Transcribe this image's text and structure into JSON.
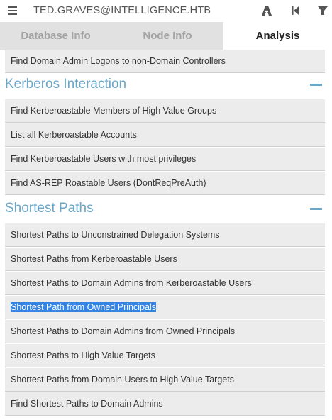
{
  "header": {
    "user": "TED.GRAVES@INTELLIGENCE.HTB",
    "menu_icon": "hamburger-icon",
    "icons": [
      "pathfinding-icon",
      "back-icon",
      "filter-icon"
    ]
  },
  "tabs": [
    {
      "label": "Database Info",
      "active": false
    },
    {
      "label": "Node Info",
      "active": false
    },
    {
      "label": "Analysis",
      "active": true
    }
  ],
  "queries_top": [
    {
      "label": "Find Domain Admin Logons to non-Domain Controllers"
    }
  ],
  "kerberos": {
    "title": "Kerberos Interaction",
    "items": [
      {
        "label": "Find Kerberoastable Members of High Value Groups"
      },
      {
        "label": "List all Kerberoastable Accounts"
      },
      {
        "label": "Find Kerberoastable Users with most privileges"
      },
      {
        "label": "Find AS-REP Roastable Users (DontReqPreAuth)"
      }
    ]
  },
  "shortest": {
    "title": "Shortest Paths",
    "items": [
      {
        "label": "Shortest Paths to Unconstrained Delegation Systems"
      },
      {
        "label": "Shortest Paths from Kerberoastable Users"
      },
      {
        "label": "Shortest Paths to Domain Admins from Kerberoastable Users"
      },
      {
        "label": "Shortest Path from Owned Principals",
        "selected": true
      },
      {
        "label": "Shortest Paths to Domain Admins from Owned Principals"
      },
      {
        "label": "Shortest Paths to High Value Targets"
      },
      {
        "label": "Shortest Paths from Domain Users to High Value Targets"
      },
      {
        "label": "Find Shortest Paths to Domain Admins"
      }
    ]
  },
  "colors": {
    "section_title": "#6aa7c9",
    "query_bg": "#ececec",
    "tab_inactive_bg": "#e1e1e1",
    "selection": "#3584e4"
  }
}
